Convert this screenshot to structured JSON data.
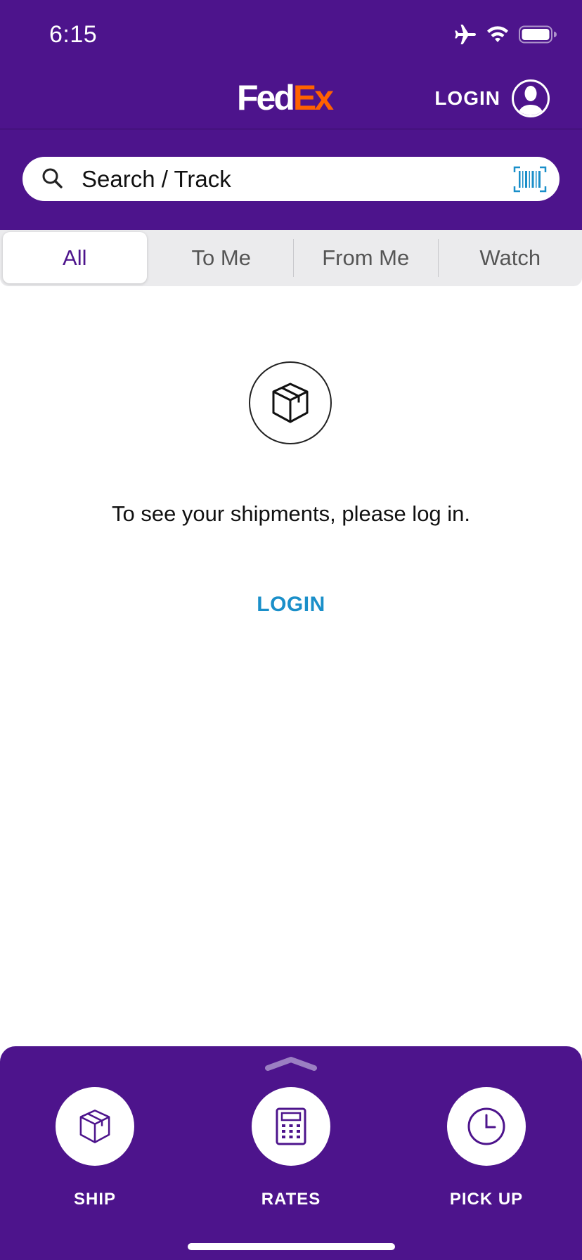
{
  "status_bar": {
    "time": "6:15",
    "icons": [
      "airplane-icon",
      "wifi-icon",
      "battery-icon"
    ]
  },
  "header": {
    "logo_fed": "Fed",
    "logo_ex": "Ex",
    "login_label": "LOGIN"
  },
  "search": {
    "placeholder": "Search / Track",
    "value": ""
  },
  "tabs": [
    {
      "label": "All",
      "selected": true
    },
    {
      "label": "To Me",
      "selected": false
    },
    {
      "label": "From Me",
      "selected": false
    },
    {
      "label": "Watch",
      "selected": false
    }
  ],
  "empty_state": {
    "icon": "package-icon",
    "message": "To see your shipments, please log in.",
    "login_link": "LOGIN"
  },
  "bottom_actions": [
    {
      "label": "SHIP",
      "icon": "package-icon"
    },
    {
      "label": "RATES",
      "icon": "calculator-icon"
    },
    {
      "label": "PICK UP",
      "icon": "clock-icon"
    }
  ],
  "colors": {
    "brand_purple": "#4d148c",
    "brand_orange": "#ff6200",
    "link_blue": "#1a8fc9",
    "segment_bg": "#ebebed"
  }
}
